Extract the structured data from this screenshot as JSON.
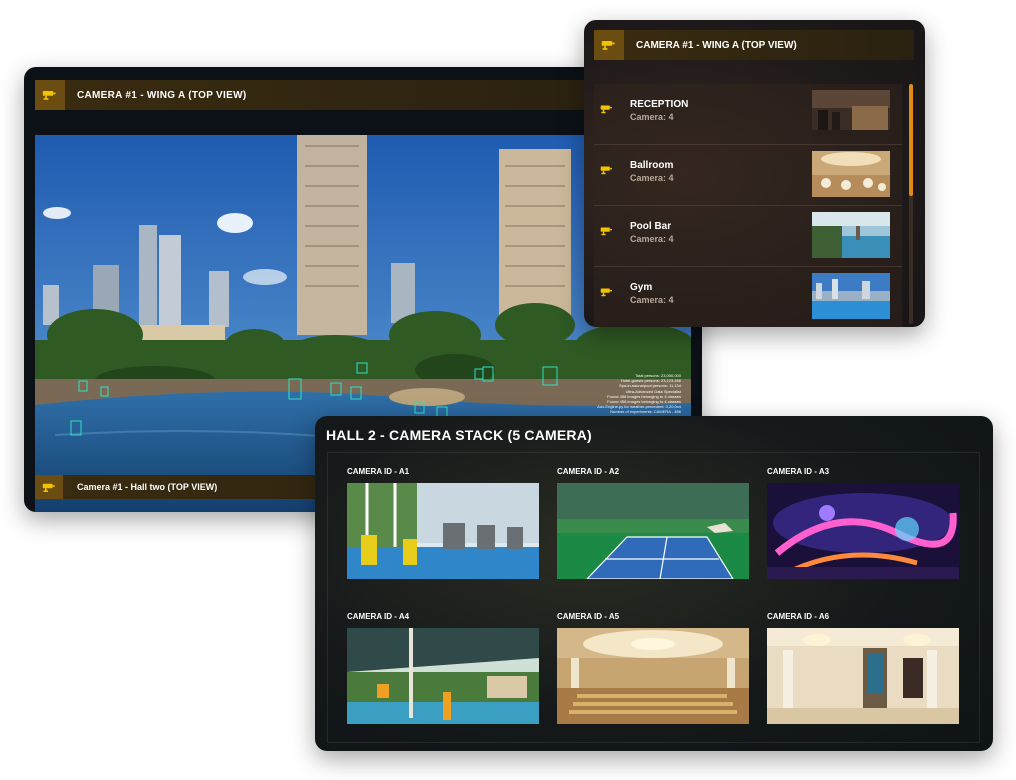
{
  "main_panel": {
    "header_title": "CAMERA #1 - WING A (TOP VIEW)",
    "footer_title": "Camera #1 - Hall two (TOP VIEW)",
    "overlay_lines": [
      "Total persons: 23,000,000",
      "Hotel-guests persons: 23,123,456",
      "Spa-in-sauna/pool persons: 11,134",
      "Ultra-Advanced Data Specialist",
      "Found 456 images belonging to 4 classes",
      "Found 456 images belonging to 4 classes",
      "Aux-Engine.py for weather-precedent: 0,20,0x4",
      "Number of experiments: CAMERA - 456",
      "Number of experiments: CAMERA - 456",
      "1740 ACC - 1340 - 1 1/2 456",
      "1740 ACC - time 2,3455 - 1x4 0,0,4564"
    ]
  },
  "list_panel": {
    "header_title": "CAMERA #1 - WING A (TOP VIEW)",
    "items": [
      {
        "title": "RECEPTION",
        "subtitle": "Camera: 4"
      },
      {
        "title": "Ballroom",
        "subtitle": "Camera: 4"
      },
      {
        "title": "Pool Bar",
        "subtitle": "Camera: 4"
      },
      {
        "title": "Gym",
        "subtitle": "Camera: 4"
      }
    ],
    "scroll_position": 0
  },
  "stack_panel": {
    "title": "HALL 2 - CAMERA STACK (5 CAMERA)",
    "tiles": [
      {
        "label": "CAMERA ID - A1"
      },
      {
        "label": "CAMERA ID - A2"
      },
      {
        "label": "CAMERA ID - A3"
      },
      {
        "label": "CAMERA ID - A4"
      },
      {
        "label": "CAMERA ID - A5"
      },
      {
        "label": "CAMERA ID - A6"
      }
    ]
  },
  "icons": {
    "camera": "cctv-camera-icon"
  },
  "colors": {
    "accent": "#e38a14",
    "icon_yellow": "#f2c400",
    "header_bg": "#3a2c10",
    "detection_box": "#2fe0c0"
  }
}
